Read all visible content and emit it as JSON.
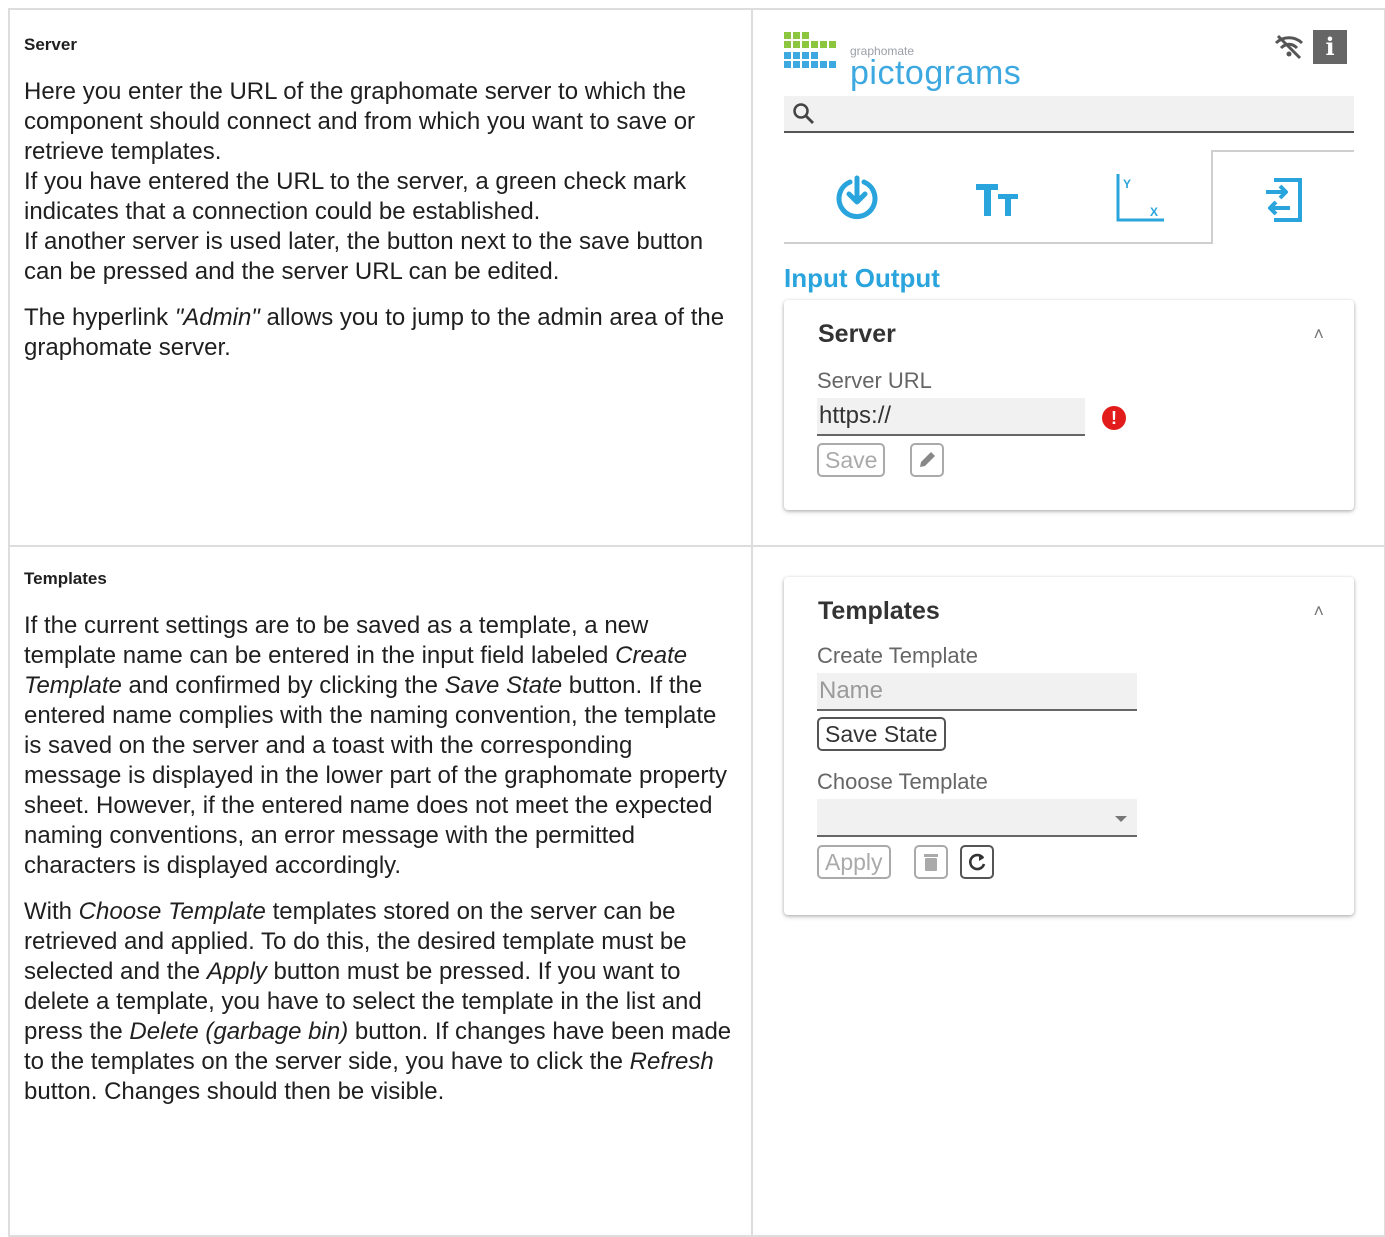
{
  "server_section": {
    "heading": "Server",
    "paragraphs": [
      [
        {
          "t": "Here you enter the URL of the graphomate server to which the component should connect and from which you want to save or retrieve templates."
        },
        {
          "br": true
        },
        {
          "t": "If you have entered the URL to the server, a green check mark indicates that a connection could be established."
        },
        {
          "br": true
        },
        {
          "t": "If another server is used later, the button next to the save button can be pressed and the server URL can be edited."
        }
      ],
      [
        {
          "t": "The hyperlink "
        },
        {
          "t": "\"Admin\"",
          "em": true
        },
        {
          "t": " allows you to jump to the admin area of the graphomate server."
        }
      ]
    ]
  },
  "templates_section": {
    "heading": "Templates",
    "paragraphs": [
      [
        {
          "t": "If the current settings are to be saved as a template, a new template name can be entered in the input field labeled "
        },
        {
          "t": "Create Template",
          "em": true
        },
        {
          "t": " and confirmed by clicking the "
        },
        {
          "t": "Save State",
          "em": true
        },
        {
          "t": " button. If the entered name complies with the naming convention, the template is saved on the server and a toast with the corresponding message is displayed in the lower part of the graphomate property sheet. However, if the entered name does not meet the expected naming conventions, an error message with the permitted characters is displayed accordingly."
        }
      ],
      [
        {
          "t": "With "
        },
        {
          "t": "Choose Template",
          "em": true
        },
        {
          "t": " templates stored on the server can be retrieved and applied. To do this, the desired template must be selected and the "
        },
        {
          "t": "Apply",
          "em": true
        },
        {
          "t": " button must be pressed. If you want to delete a template, you have to select the template in the list and press the "
        },
        {
          "t": "Delete (garbage bin)",
          "em": true
        },
        {
          "t": " button. If changes have been made to the templates on the server side, you have to click the "
        },
        {
          "t": "Refresh",
          "em": true
        },
        {
          "t": " button. Changes should then be visible."
        }
      ]
    ]
  },
  "panel": {
    "logo_small": "graphomate",
    "logo_big": "pictograms",
    "info_label": "i",
    "section_title": "Input Output",
    "colors": {
      "accent": "#2aa4dc",
      "logo_green": "#8cc63f",
      "logo_blue": "#3ea9e0",
      "error": "#e21b1b"
    },
    "tabs": [
      {
        "icon": "download-circle-icon"
      },
      {
        "icon": "text-size-icon"
      },
      {
        "icon": "axis-xy-icon"
      },
      {
        "icon": "input-output-icon",
        "active": true
      }
    ],
    "server_card": {
      "title": "Server",
      "url_label": "Server URL",
      "url_value": "https://",
      "save_label": "Save"
    },
    "templates_card": {
      "title": "Templates",
      "create_label": "Create Template",
      "name_placeholder": "Name",
      "save_state_label": "Save State",
      "choose_label": "Choose Template",
      "apply_label": "Apply"
    }
  }
}
